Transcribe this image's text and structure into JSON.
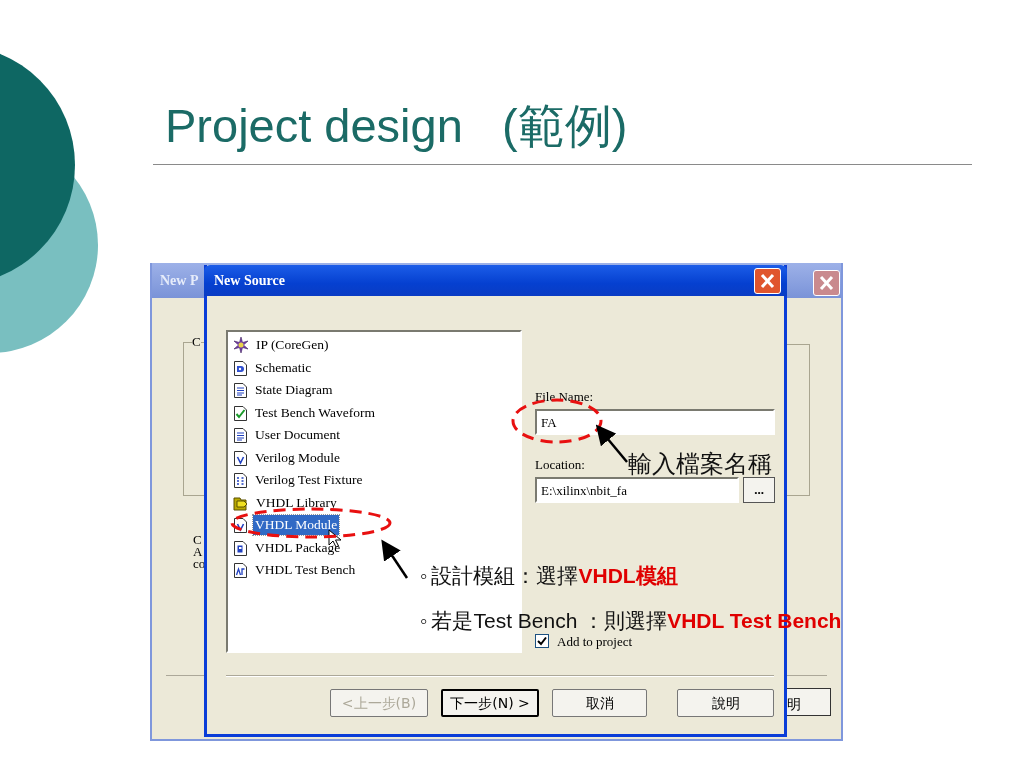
{
  "slide": {
    "title": "Project design   (範例)"
  },
  "back_window": {
    "title": "New P",
    "group_label": "C",
    "fragments": [
      "C",
      "A",
      "co"
    ],
    "button_fragment": "明"
  },
  "dialog": {
    "title": "New Source",
    "source_types": [
      {
        "label": "IP (CoreGen)",
        "kind": "coregen",
        "selected": false
      },
      {
        "label": "Schematic",
        "kind": "schematic",
        "selected": false
      },
      {
        "label": "State Diagram",
        "kind": "doc",
        "selected": false
      },
      {
        "label": "Test Bench Waveform",
        "kind": "waveform",
        "selected": false
      },
      {
        "label": "User Document",
        "kind": "doc",
        "selected": false
      },
      {
        "label": "Verilog Module",
        "kind": "module",
        "selected": false
      },
      {
        "label": "Verilog Test Fixture",
        "kind": "fixture",
        "selected": false
      },
      {
        "label": "VHDL Library",
        "kind": "library",
        "selected": false
      },
      {
        "label": "VHDL Module",
        "kind": "module",
        "selected": true
      },
      {
        "label": "VHDL Package",
        "kind": "package",
        "selected": false
      },
      {
        "label": "VHDL Test Bench",
        "kind": "testbench",
        "selected": false
      }
    ],
    "file_name": {
      "label": "File Name:",
      "value": "FA"
    },
    "location": {
      "label": "Location:",
      "value": "E:\\xilinx\\nbit_fa",
      "browse": "..."
    },
    "add_to_project": {
      "label": "Add to project",
      "checked": true
    },
    "buttons": [
      {
        "label": "<上一步(B)",
        "disabled": true,
        "default": false
      },
      {
        "label": "下一步(N) >",
        "disabled": false,
        "default": true
      },
      {
        "label": "取消",
        "disabled": false,
        "default": false
      },
      {
        "label": "說明",
        "disabled": false,
        "default": false
      }
    ]
  },
  "annotations": {
    "file_note": "輸入檔案名稱",
    "bullets": [
      {
        "marker": "◦",
        "text": "設計模組：選擇**VHDL模組**"
      },
      {
        "marker": "◦",
        "text": "若是Test Bench ：則選擇**VHDL Test Bench**"
      }
    ]
  }
}
